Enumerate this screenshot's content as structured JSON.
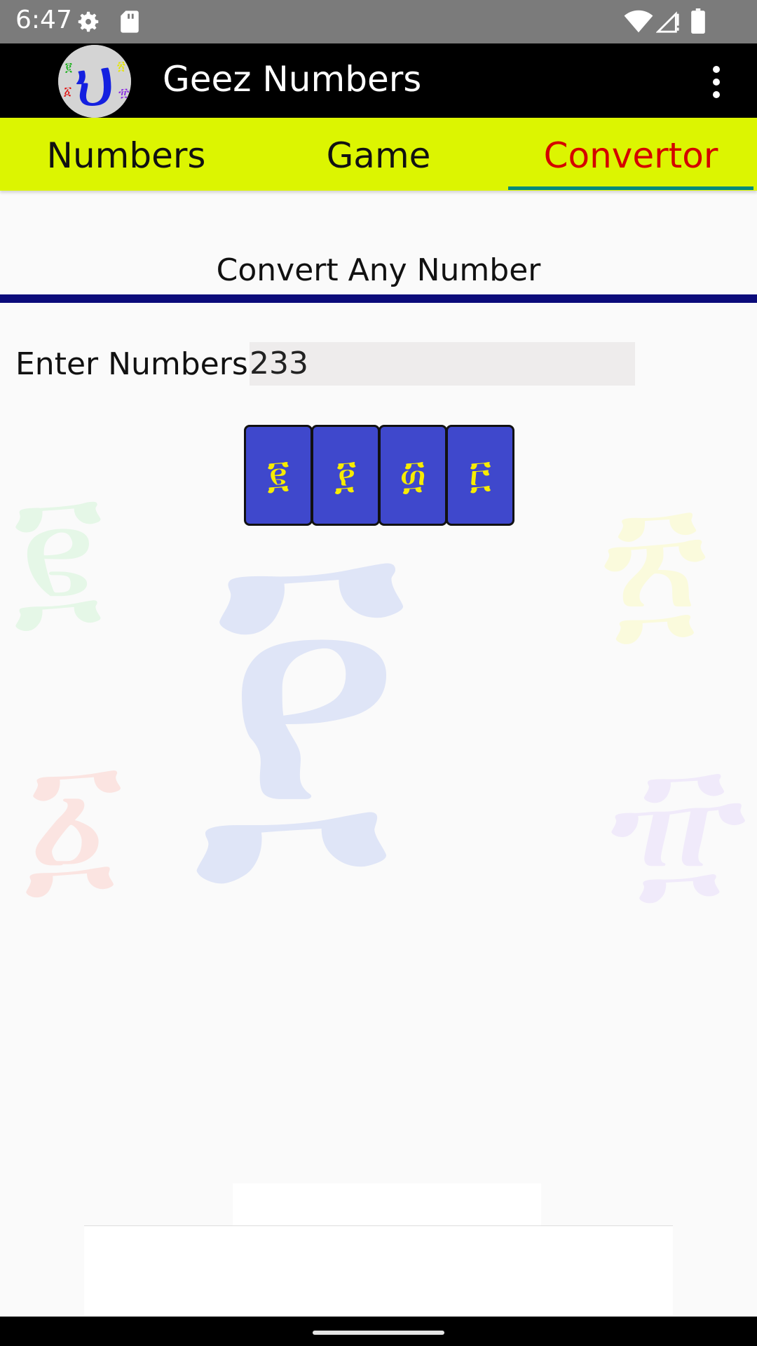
{
  "status_bar": {
    "time": "6:47",
    "icons": [
      "gear-icon",
      "sd-card-icon",
      "wifi-icon",
      "signal-icon",
      "battery-icon"
    ]
  },
  "app_bar": {
    "title": "Geez Numbers",
    "logo_glyph": "፻",
    "menu_icon": "overflow-menu-icon"
  },
  "tabs": [
    {
      "label": "Numbers",
      "active": false
    },
    {
      "label": "Game",
      "active": false
    },
    {
      "label": "Convertor",
      "active": true
    }
  ],
  "converter": {
    "title": "Convert Any Number",
    "input_label": "Enter Numbers :",
    "input_value": "233",
    "result_tiles": [
      "፪",
      "፻",
      "፴",
      "፫"
    ]
  },
  "watermarks": {
    "center": "፻",
    "top_left": "፪",
    "top_right": "፳",
    "bottom_left": "፩",
    "bottom_right": "፹"
  },
  "colors": {
    "tab_bar": "#dcf501",
    "active_tab": "#d40000",
    "tab_indicator": "#00897b",
    "divider": "#0b0b7a",
    "tile_bg": "#3f48cc",
    "tile_fg": "#f7ec00"
  }
}
